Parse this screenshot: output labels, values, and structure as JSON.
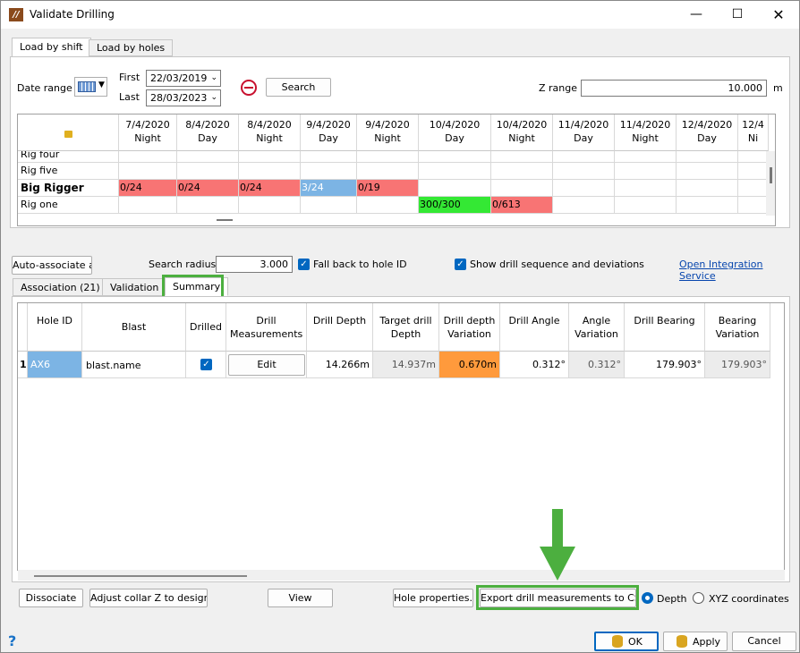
{
  "window": {
    "title": "Validate Drilling"
  },
  "top_tabs": [
    "Load by shift",
    "Load by holes"
  ],
  "filter": {
    "date_range_label": "Date range",
    "first_label": "First",
    "first_value": "22/03/2019",
    "last_label": "Last",
    "last_value": "28/03/2023",
    "search_label": "Search",
    "z_range_label": "Z range",
    "z_range_value": "10.000",
    "z_unit": "m"
  },
  "shift_grid": {
    "columns": [
      [
        "7/4/2020",
        "Night"
      ],
      [
        "8/4/2020",
        "Day"
      ],
      [
        "8/4/2020",
        "Night"
      ],
      [
        "9/4/2020",
        "Day"
      ],
      [
        "9/4/2020",
        "Night"
      ],
      [
        "10/4/2020",
        "Day"
      ],
      [
        "10/4/2020",
        "Night"
      ],
      [
        "11/4/2020",
        "Day"
      ],
      [
        "11/4/2020",
        "Night"
      ],
      [
        "12/4/2020",
        "Day"
      ],
      [
        "12/4",
        "Ni"
      ]
    ],
    "rows": [
      {
        "name": "Rig four",
        "cells": [
          "",
          "",
          "",
          "",
          "",
          "",
          "",
          "",
          "",
          "",
          ""
        ]
      },
      {
        "name": "Rig five",
        "cells": [
          "",
          "",
          "",
          "",
          "",
          "",
          "",
          "",
          "",
          "",
          ""
        ]
      },
      {
        "name": "Big Rigger",
        "cells": [
          "0/24",
          "0/24",
          "0/24",
          "3/24",
          "0/19",
          "",
          "",
          "",
          "",
          "",
          ""
        ]
      },
      {
        "name": "Rig one",
        "cells": [
          "",
          "",
          "",
          "",
          "",
          "300/300",
          "0/613",
          "",
          "",
          "",
          ""
        ]
      }
    ]
  },
  "options": {
    "auto_associate": "Auto-associate all",
    "search_radius_label": "Search radius",
    "search_radius_value": "3.000",
    "fallback_label": "Fall back to hole ID",
    "show_seq_label": "Show drill sequence and deviations",
    "open_integration": "Open Integration Service"
  },
  "sub_tabs": [
    "Association (21)",
    "Validation",
    "Summary"
  ],
  "summary": {
    "headers": [
      "Hole ID",
      "Blast",
      "Drilled",
      "Drill Measurements",
      "Drill Depth",
      "Target drill Depth",
      "Drill depth Variation",
      "Drill Angle",
      "Angle Variation",
      "Drill Bearing",
      "Bearing Variation"
    ],
    "row": {
      "index": "1",
      "hole_id": "AX6",
      "blast": "blast.name",
      "edit": "Edit",
      "drill_depth": "14.266m",
      "target_depth": "14.937m",
      "depth_var": "0.670m",
      "drill_angle": "0.312°",
      "angle_var": "0.312°",
      "bearing": "179.903°",
      "bearing_var": "179.903°"
    }
  },
  "bottom_buttons": {
    "dissociate": "Dissociate",
    "adjust": "Adjust collar Z to design...",
    "view": "View",
    "hole_props": "Hole properties...",
    "export": "Export drill measurements to CSV...",
    "depth": "Depth",
    "xyz": "XYZ coordinates"
  },
  "footer": {
    "help": "?",
    "ok": "OK",
    "apply": "Apply",
    "cancel": "Cancel"
  },
  "colors": {
    "red": "#f87474",
    "blue": "#7cb4e4",
    "green": "#34e834",
    "orange": "#ff9a3c",
    "highlight": "#4caf3f"
  }
}
